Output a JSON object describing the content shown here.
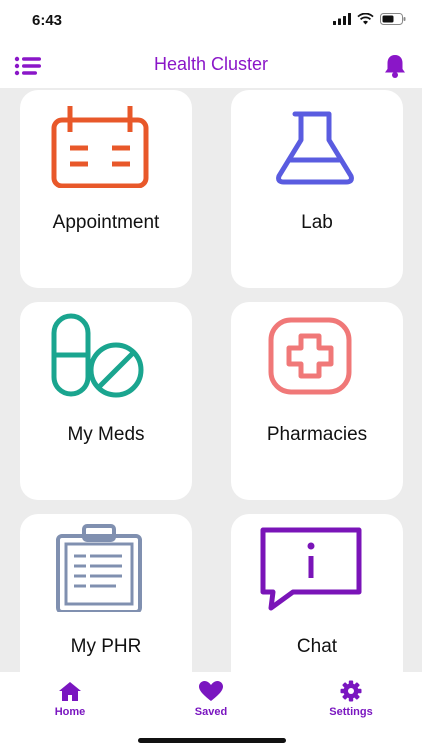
{
  "status_bar": {
    "time": "6:43"
  },
  "header": {
    "title": "Health Cluster"
  },
  "cards": [
    {
      "label": "Appointment",
      "icon": "calendar-icon",
      "color": "#e8582a"
    },
    {
      "label": "Lab",
      "icon": "flask-icon",
      "color": "#5a5ce0"
    },
    {
      "label": "My Meds",
      "icon": "pills-icon",
      "color": "#1aa58f"
    },
    {
      "label": "Pharmacies",
      "icon": "medical-cross-icon",
      "color": "#f07878"
    },
    {
      "label": "My PHR",
      "icon": "clipboard-icon",
      "color": "#8090b0"
    },
    {
      "label": "Chat",
      "icon": "info-chat-icon",
      "color": "#7a14b8"
    }
  ],
  "tabbar": {
    "items": [
      {
        "label": "Home",
        "icon": "home-icon"
      },
      {
        "label": "Saved",
        "icon": "heart-icon"
      },
      {
        "label": "Settings",
        "icon": "gear-icon"
      }
    ]
  },
  "colors": {
    "accent": "#8a16c8",
    "background": "#ececec",
    "card": "#ffffff"
  }
}
